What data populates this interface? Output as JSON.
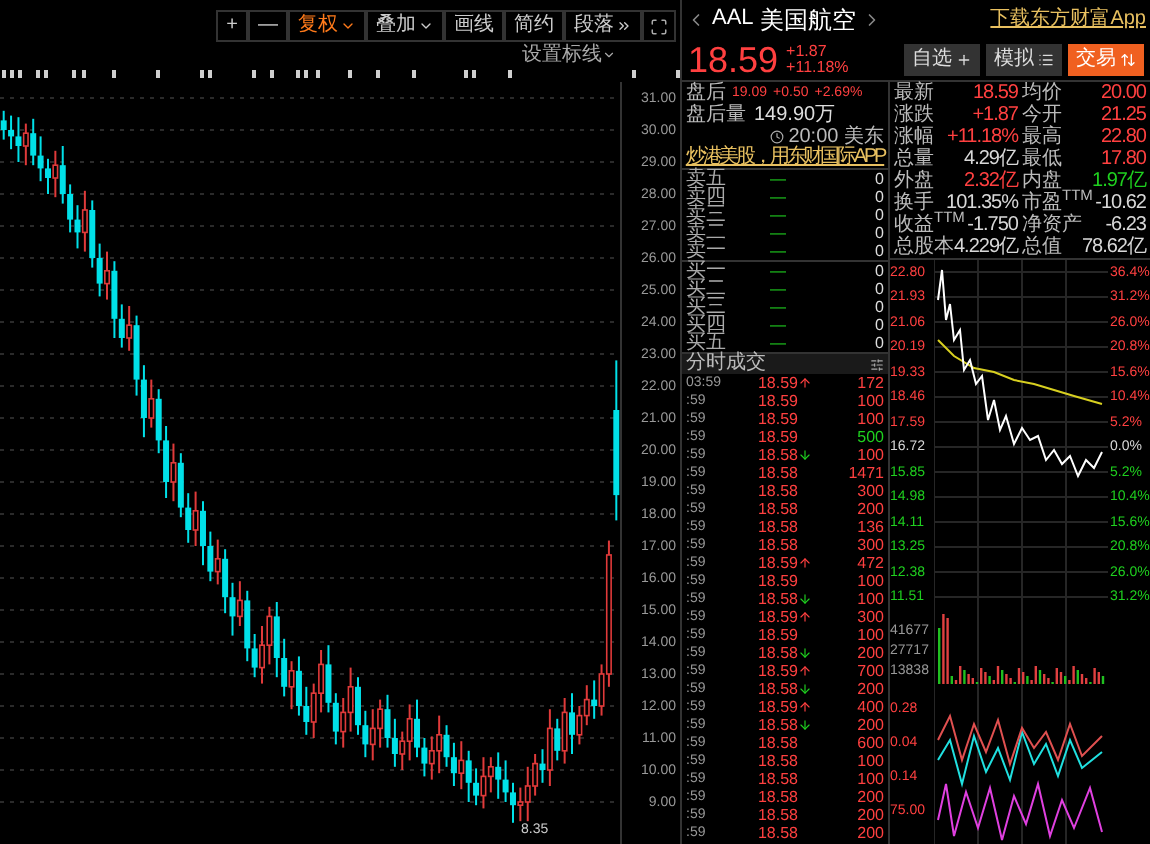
{
  "toolbar": {
    "buttons": [
      {
        "label": "+",
        "kind": "plain",
        "active": false
      },
      {
        "label": "—",
        "kind": "plain",
        "active": false
      },
      {
        "label": "复权",
        "kind": "dropdown",
        "active": true
      },
      {
        "label": "叠加",
        "kind": "dropdown",
        "active": false
      },
      {
        "label": "画线",
        "kind": "plain",
        "active": false
      },
      {
        "label": "简约",
        "kind": "plain",
        "active": false
      },
      {
        "label": "段落",
        "kind": "more",
        "active": false
      }
    ],
    "line_setting": "设置标线"
  },
  "kline": {
    "low_label": "8.35",
    "chart_data": {
      "type": "candlestick",
      "categories": [
        null,
        null,
        null,
        null,
        null,
        null,
        null,
        null,
        null,
        null,
        null,
        null,
        null,
        null,
        null,
        null,
        null,
        null,
        null,
        null,
        null,
        null,
        null,
        null,
        null,
        null,
        null,
        null,
        null,
        null,
        null,
        null,
        null,
        null,
        null,
        null,
        null,
        null,
        null,
        null,
        null,
        null,
        null,
        null,
        null,
        null,
        null,
        null,
        null,
        null,
        null,
        null,
        null,
        null,
        null,
        null,
        null,
        null,
        null,
        null,
        null,
        null,
        null,
        null,
        null,
        null,
        null,
        null,
        null,
        null,
        null,
        null,
        null,
        null,
        null,
        null,
        null,
        null,
        null,
        null,
        null,
        null,
        null,
        null
      ],
      "ohlc": [
        [
          30.3,
          30.6,
          29.7,
          30.0
        ],
        [
          30.0,
          30.45,
          29.4,
          29.8
        ],
        [
          29.8,
          30.4,
          29.0,
          29.5
        ],
        [
          29.5,
          30.2,
          28.9,
          29.9
        ],
        [
          29.9,
          30.35,
          28.9,
          29.2
        ],
        [
          29.2,
          29.8,
          28.4,
          28.8
        ],
        [
          28.8,
          29.1,
          28.0,
          28.5
        ],
        [
          28.5,
          29.35,
          27.9,
          28.9
        ],
        [
          28.9,
          29.5,
          27.7,
          28.0
        ],
        [
          28.0,
          28.3,
          26.8,
          27.2
        ],
        [
          27.2,
          27.65,
          26.3,
          26.8
        ],
        [
          26.8,
          28.1,
          26.2,
          27.5
        ],
        [
          27.5,
          27.8,
          25.7,
          26.0
        ],
        [
          26.0,
          26.45,
          24.8,
          25.2
        ],
        [
          25.2,
          26.2,
          24.7,
          25.6
        ],
        [
          25.6,
          25.9,
          23.5,
          24.1
        ],
        [
          24.1,
          24.55,
          23.2,
          23.5
        ],
        [
          23.5,
          24.5,
          23.1,
          23.9
        ],
        [
          23.9,
          24.2,
          21.7,
          22.2
        ],
        [
          22.2,
          22.65,
          20.4,
          21.0
        ],
        [
          21.0,
          22.2,
          20.7,
          21.6
        ],
        [
          21.6,
          21.9,
          19.9,
          20.3
        ],
        [
          20.3,
          20.75,
          18.5,
          19.0
        ],
        [
          19.0,
          20.2,
          18.4,
          19.6
        ],
        [
          19.6,
          19.9,
          17.9,
          18.2
        ],
        [
          18.2,
          18.65,
          17.1,
          17.5
        ],
        [
          17.5,
          18.7,
          17.0,
          18.1
        ],
        [
          18.1,
          18.4,
          16.4,
          17.0
        ],
        [
          17.0,
          17.45,
          15.9,
          16.2
        ],
        [
          16.2,
          17.2,
          15.8,
          16.6
        ],
        [
          16.6,
          16.9,
          14.9,
          15.4
        ],
        [
          15.4,
          15.85,
          14.2,
          14.8
        ],
        [
          14.8,
          15.9,
          14.5,
          15.3
        ],
        [
          15.3,
          15.6,
          13.4,
          13.8
        ],
        [
          13.8,
          14.25,
          12.9,
          13.2
        ],
        [
          13.2,
          14.5,
          12.7,
          13.9
        ],
        [
          13.9,
          15.1,
          13.3,
          14.8
        ],
        [
          14.8,
          15.25,
          12.9,
          13.5
        ],
        [
          13.5,
          14.1,
          12.3,
          12.6
        ],
        [
          12.6,
          13.4,
          11.9,
          13.1
        ],
        [
          13.1,
          13.55,
          11.7,
          12.0
        ],
        [
          12.0,
          12.6,
          11.1,
          11.5
        ],
        [
          11.5,
          12.7,
          11.0,
          12.4
        ],
        [
          12.4,
          13.75,
          11.8,
          13.3
        ],
        [
          13.3,
          13.9,
          11.8,
          12.1
        ],
        [
          12.1,
          12.4,
          10.8,
          11.2
        ],
        [
          11.2,
          12.25,
          10.7,
          11.8
        ],
        [
          11.8,
          13.2,
          11.2,
          12.6
        ],
        [
          12.6,
          12.9,
          11.1,
          11.4
        ],
        [
          11.4,
          11.85,
          10.4,
          10.8
        ],
        [
          10.8,
          11.9,
          10.3,
          11.3
        ],
        [
          11.3,
          12.2,
          10.7,
          11.9
        ],
        [
          11.9,
          12.35,
          10.7,
          11.0
        ],
        [
          11.0,
          11.6,
          10.1,
          10.5
        ],
        [
          10.5,
          11.2,
          10.0,
          10.9
        ],
        [
          10.9,
          12.05,
          10.3,
          11.6
        ],
        [
          11.6,
          12.2,
          10.4,
          10.7
        ],
        [
          10.7,
          11.0,
          9.8,
          10.2
        ],
        [
          10.2,
          11.05,
          9.7,
          10.6
        ],
        [
          10.6,
          11.7,
          9.9,
          11.1
        ],
        [
          11.1,
          11.4,
          10.1,
          10.4
        ],
        [
          10.4,
          10.85,
          9.5,
          9.9
        ],
        [
          9.9,
          10.9,
          9.4,
          10.3
        ],
        [
          10.3,
          10.6,
          9.0,
          9.6
        ],
        [
          9.6,
          10.05,
          8.9,
          9.2
        ],
        [
          9.2,
          10.4,
          8.8,
          9.8
        ],
        [
          9.8,
          10.4,
          9.3,
          10.1
        ],
        [
          10.1,
          10.55,
          9.1,
          9.7
        ],
        [
          9.7,
          10.3,
          9.0,
          9.3
        ],
        [
          9.3,
          9.6,
          8.35,
          8.9
        ],
        [
          8.9,
          9.45,
          8.4,
          9.0
        ],
        [
          9.0,
          10.1,
          8.4,
          9.5
        ],
        [
          9.5,
          10.5,
          9.2,
          10.2
        ],
        [
          10.2,
          10.65,
          9.6,
          10.0
        ],
        [
          10.0,
          11.9,
          9.5,
          11.3
        ],
        [
          11.3,
          11.6,
          10.3,
          10.6
        ],
        [
          10.6,
          12.25,
          10.2,
          11.8
        ],
        [
          11.8,
          12.4,
          10.5,
          11.1
        ],
        [
          11.1,
          12.0,
          10.8,
          11.7
        ],
        [
          11.7,
          12.65,
          11.4,
          12.2
        ],
        [
          12.2,
          12.8,
          11.6,
          12.0
        ],
        [
          12.0,
          13.3,
          11.7,
          13.0
        ],
        [
          13.0,
          17.17,
          12.6,
          16.72
        ],
        [
          21.25,
          22.8,
          17.8,
          18.59
        ]
      ],
      "ylim": [
        7.6875,
        31.5
      ],
      "grid": true,
      "yticks": [
        {
          "value": 31,
          "label": "31.00"
        },
        {
          "value": 30,
          "label": "30.00"
        },
        {
          "value": 29,
          "label": "29.00"
        },
        {
          "value": 28,
          "label": "28.00"
        },
        {
          "value": 27,
          "label": "27.00"
        },
        {
          "value": 26,
          "label": "26.00"
        },
        {
          "value": 25,
          "label": "25.00"
        },
        {
          "value": 24,
          "label": "24.00"
        },
        {
          "value": 23,
          "label": "23.00"
        },
        {
          "value": 22,
          "label": "22.00"
        },
        {
          "value": 21,
          "label": "21.00"
        },
        {
          "value": 20,
          "label": "20.00"
        },
        {
          "value": 19,
          "label": "19.00"
        },
        {
          "value": 18,
          "label": "18.00"
        },
        {
          "value": 17,
          "label": "17.00"
        },
        {
          "value": 16,
          "label": "16.00"
        },
        {
          "value": 15,
          "label": "15.00"
        },
        {
          "value": 14,
          "label": "14.00"
        },
        {
          "value": 13,
          "label": "13.00"
        },
        {
          "value": 12,
          "label": "12.00"
        },
        {
          "value": 11,
          "label": "11.00"
        },
        {
          "value": 10,
          "label": "10.00"
        },
        {
          "value": 9,
          "label": "9.00"
        }
      ]
    }
  },
  "quote": {
    "symbol": "AAL",
    "name": "美国航空",
    "link": "下载东方财富App",
    "price": "18.59",
    "change": "+1.87",
    "change_pct": "+11.18%",
    "buttons": [
      {
        "label": "自选",
        "kind": "add",
        "primary": false
      },
      {
        "label": "模拟",
        "kind": "sim",
        "primary": false
      },
      {
        "label": "交易",
        "kind": "trade",
        "primary": true
      }
    ]
  },
  "after_hours": {
    "label": "盘后",
    "price": "19.09",
    "change": "+0.50",
    "change_pct": "+2.69%",
    "volume_label": "盘后量",
    "volume": "149.90万",
    "time": "20:00 美东"
  },
  "ad": "炒港美股，用东财国际APP",
  "order_book": {
    "asks": [
      {
        "label": "卖五",
        "price": "—",
        "volume": "0"
      },
      {
        "label": "卖四",
        "price": "—",
        "volume": "0"
      },
      {
        "label": "卖三",
        "price": "—",
        "volume": "0"
      },
      {
        "label": "卖二",
        "price": "—",
        "volume": "0"
      },
      {
        "label": "卖一",
        "price": "—",
        "volume": "0"
      }
    ],
    "bids": [
      {
        "label": "买一",
        "price": "—",
        "volume": "0"
      },
      {
        "label": "买二",
        "price": "—",
        "volume": "0"
      },
      {
        "label": "买三",
        "price": "—",
        "volume": "0"
      },
      {
        "label": "买四",
        "price": "—",
        "volume": "0"
      },
      {
        "label": "买五",
        "price": "—",
        "volume": "0"
      }
    ]
  },
  "stats": [
    [
      {
        "label": "最新",
        "value": "18.59",
        "color": "#ff4040"
      },
      {
        "label": "均价",
        "value": "20.00",
        "color": "#ff4040"
      }
    ],
    [
      {
        "label": "涨跌",
        "value": "+1.87",
        "color": "#ff4040"
      },
      {
        "label": "今开",
        "value": "21.25",
        "color": "#ff4040"
      }
    ],
    [
      {
        "label": "涨幅",
        "value": "+11.18%",
        "color": "#ff4040"
      },
      {
        "label": "最高",
        "value": "22.80",
        "color": "#ff4040"
      }
    ],
    [
      {
        "label": "总量",
        "value": "4.29亿",
        "color": "#d8d8d8"
      },
      {
        "label": "最低",
        "value": "17.80",
        "color": "#ff4040"
      }
    ],
    [
      {
        "label": "外盘",
        "value": "2.32亿",
        "color": "#ff4040"
      },
      {
        "label": "内盘",
        "value": "1.97亿",
        "color": "#1fd01f"
      }
    ],
    [
      {
        "label": "换手",
        "value": "101.35%",
        "color": "#d8d8d8"
      },
      {
        "label": "市盈$^{TTM}$",
        "value": "-10.62",
        "color": "#d8d8d8"
      }
    ],
    [
      {
        "label": "收益$^{TTM}$",
        "value": "-1.750",
        "color": "#d8d8d8"
      },
      {
        "label": "净资产",
        "value": "-6.23",
        "color": "#d8d8d8"
      }
    ],
    [
      {
        "label": "总股本",
        "value": "4.229亿",
        "color": "#d8d8d8"
      },
      {
        "label": "总值",
        "value": "78.62亿",
        "color": "#d8d8d8"
      }
    ]
  ],
  "trades": {
    "title": "分时成交",
    "rows": [
      {
        "time": "03:59",
        "price": "18.59",
        "arrow_up": true,
        "arrow_down": false,
        "volume": "172",
        "color": "#ff4040"
      },
      {
        "time": ":59",
        "price": "18.59",
        "arrow_up": false,
        "arrow_down": false,
        "volume": "100",
        "color": "#ff4040"
      },
      {
        "time": ":59",
        "price": "18.59",
        "arrow_up": false,
        "arrow_down": false,
        "volume": "100",
        "color": "#ff4040"
      },
      {
        "time": ":59",
        "price": "18.59",
        "arrow_up": false,
        "arrow_down": false,
        "volume": "500",
        "color": "#1fd01f"
      },
      {
        "time": ":59",
        "price": "18.58",
        "arrow_up": false,
        "arrow_down": true,
        "volume": "100",
        "color": "#ff4040"
      },
      {
        "time": ":59",
        "price": "18.58",
        "arrow_up": false,
        "arrow_down": false,
        "volume": "1471",
        "color": "#ff4040"
      },
      {
        "time": ":59",
        "price": "18.58",
        "arrow_up": false,
        "arrow_down": false,
        "volume": "300",
        "color": "#ff4040"
      },
      {
        "time": ":59",
        "price": "18.58",
        "arrow_up": false,
        "arrow_down": false,
        "volume": "200",
        "color": "#ff4040"
      },
      {
        "time": ":59",
        "price": "18.58",
        "arrow_up": false,
        "arrow_down": false,
        "volume": "136",
        "color": "#ff4040"
      },
      {
        "time": ":59",
        "price": "18.58",
        "arrow_up": false,
        "arrow_down": false,
        "volume": "300",
        "color": "#ff4040"
      },
      {
        "time": ":59",
        "price": "18.59",
        "arrow_up": true,
        "arrow_down": false,
        "volume": "472",
        "color": "#ff4040"
      },
      {
        "time": ":59",
        "price": "18.59",
        "arrow_up": false,
        "arrow_down": false,
        "volume": "100",
        "color": "#ff4040"
      },
      {
        "time": ":59",
        "price": "18.58",
        "arrow_up": false,
        "arrow_down": true,
        "volume": "100",
        "color": "#ff4040"
      },
      {
        "time": ":59",
        "price": "18.59",
        "arrow_up": true,
        "arrow_down": false,
        "volume": "300",
        "color": "#ff4040"
      },
      {
        "time": ":59",
        "price": "18.59",
        "arrow_up": false,
        "arrow_down": false,
        "volume": "100",
        "color": "#ff4040"
      },
      {
        "time": ":59",
        "price": "18.58",
        "arrow_up": false,
        "arrow_down": true,
        "volume": "200",
        "color": "#ff4040"
      },
      {
        "time": ":59",
        "price": "18.59",
        "arrow_up": true,
        "arrow_down": false,
        "volume": "700",
        "color": "#ff4040"
      },
      {
        "time": ":59",
        "price": "18.58",
        "arrow_up": false,
        "arrow_down": true,
        "volume": "200",
        "color": "#ff4040"
      },
      {
        "time": ":59",
        "price": "18.59",
        "arrow_up": true,
        "arrow_down": false,
        "volume": "400",
        "color": "#ff4040"
      },
      {
        "time": ":59",
        "price": "18.58",
        "arrow_up": false,
        "arrow_down": true,
        "volume": "200",
        "color": "#ff4040"
      },
      {
        "time": ":59",
        "price": "18.58",
        "arrow_up": false,
        "arrow_down": false,
        "volume": "600",
        "color": "#ff4040"
      },
      {
        "time": ":59",
        "price": "18.58",
        "arrow_up": false,
        "arrow_down": false,
        "volume": "100",
        "color": "#ff4040"
      },
      {
        "time": ":59",
        "price": "18.58",
        "arrow_up": false,
        "arrow_down": false,
        "volume": "100",
        "color": "#ff4040"
      },
      {
        "time": ":59",
        "price": "18.58",
        "arrow_up": false,
        "arrow_down": false,
        "volume": "200",
        "color": "#ff4040"
      },
      {
        "time": ":59",
        "price": "18.58",
        "arrow_up": false,
        "arrow_down": false,
        "volume": "200",
        "color": "#ff4040"
      },
      {
        "time": ":59",
        "price": "18.58",
        "arrow_up": false,
        "arrow_down": false,
        "volume": "200",
        "color": "#ff4040"
      }
    ]
  },
  "intraday": {
    "price_labels": [
      {
        "label": "22.80",
        "color": "#ff4040"
      },
      {
        "label": "21.93",
        "color": "#ff4040"
      },
      {
        "label": "21.06",
        "color": "#ff4040"
      },
      {
        "label": "20.19",
        "color": "#ff4040"
      },
      {
        "label": "19.33",
        "color": "#ff4040"
      },
      {
        "label": "18.46",
        "color": "#ff4040"
      },
      {
        "label": "17.59",
        "color": "#ff4040"
      },
      {
        "label": "16.72",
        "color": "#d8d8d8"
      },
      {
        "label": "15.85",
        "color": "#1fd01f"
      },
      {
        "label": "14.98",
        "color": "#1fd01f"
      },
      {
        "label": "14.11",
        "color": "#1fd01f"
      },
      {
        "label": "13.25",
        "color": "#1fd01f"
      },
      {
        "label": "12.38",
        "color": "#1fd01f"
      },
      {
        "label": "11.51",
        "color": "#1fd01f"
      }
    ],
    "pct_labels": [
      {
        "label": "36.4%",
        "color": "#ff4040"
      },
      {
        "label": "31.2%",
        "color": "#ff4040"
      },
      {
        "label": "26.0%",
        "color": "#ff4040"
      },
      {
        "label": "20.8%",
        "color": "#ff4040"
      },
      {
        "label": "15.6%",
        "color": "#ff4040"
      },
      {
        "label": "10.4%",
        "color": "#ff4040"
      },
      {
        "label": "5.2%",
        "color": "#ff4040"
      },
      {
        "label": "0.0%",
        "color": "#d8d8d8"
      },
      {
        "label": "5.2%",
        "color": "#1fd01f"
      },
      {
        "label": "10.4%",
        "color": "#1fd01f"
      },
      {
        "label": "15.6%",
        "color": "#1fd01f"
      },
      {
        "label": "20.8%",
        "color": "#1fd01f"
      },
      {
        "label": "26.0%",
        "color": "#1fd01f"
      },
      {
        "label": "31.2%",
        "color": "#1fd01f"
      }
    ],
    "volume_labels": [
      "41677",
      "27717",
      "13838"
    ],
    "indicator_labels": [
      "0.28",
      "0.04",
      "0.14",
      "75.00"
    ]
  }
}
